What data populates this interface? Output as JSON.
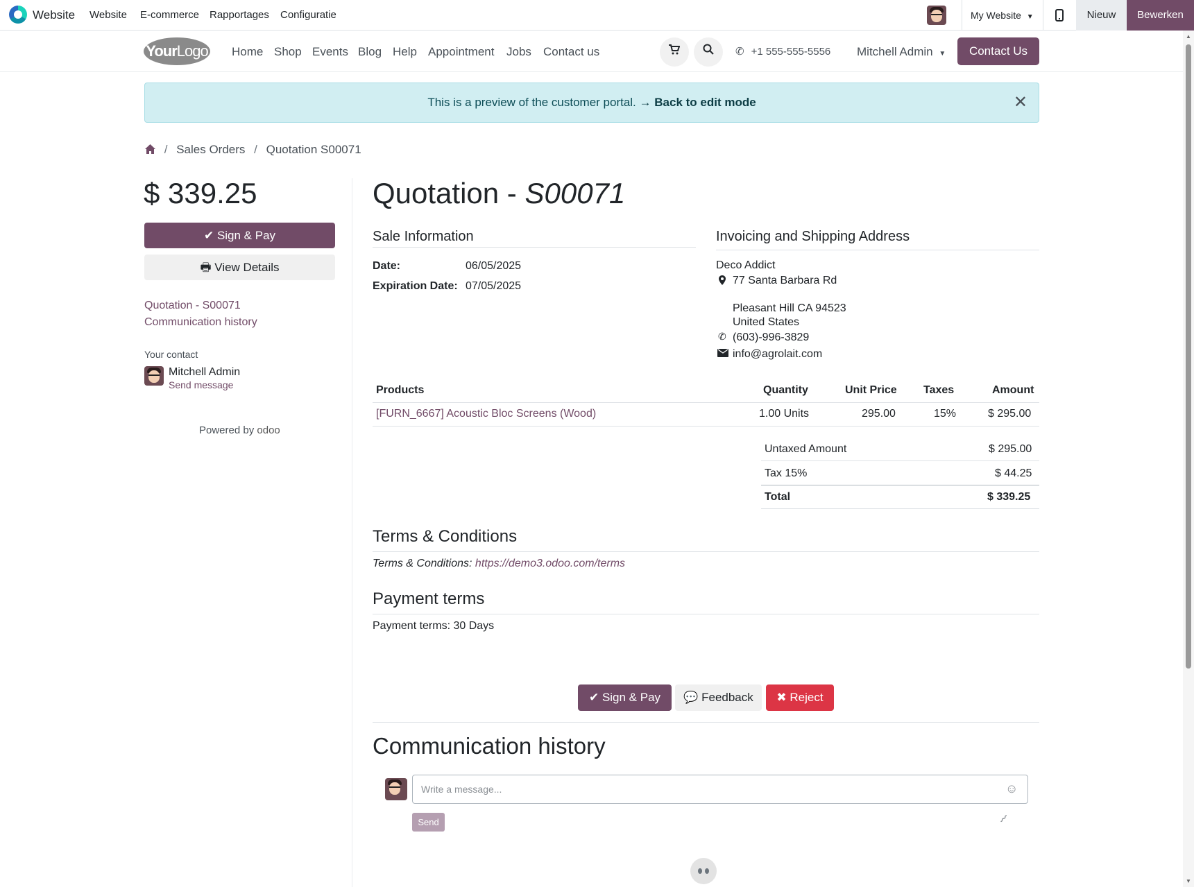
{
  "admin_bar": {
    "app_name": "Website",
    "menu": [
      "Website",
      "E-commerce",
      "Rapportages",
      "Configuratie"
    ],
    "website_selector": "My Website",
    "new_label": "Nieuw",
    "edit_label": "Bewerken"
  },
  "site_header": {
    "logo_text_bold": "Your",
    "logo_text_light": "Logo",
    "nav": [
      "Home",
      "Shop",
      "Events",
      "Blog",
      "Help",
      "Appointment",
      "Jobs",
      "Contact us"
    ],
    "phone": "+1 555-555-5556",
    "user": "Mitchell Admin",
    "contact_button": "Contact Us"
  },
  "alert": {
    "text": "This is a preview of the customer portal.",
    "link": "→ Back to edit mode"
  },
  "breadcrumb": {
    "items": [
      "Sales Orders",
      "Quotation S00071"
    ]
  },
  "sidebar": {
    "amount": "$ 339.25",
    "sign_pay": "Sign & Pay",
    "view_details": "View Details",
    "links": [
      "Quotation - S00071",
      "Communication history"
    ],
    "contact_label": "Your contact",
    "contact_name": "Mitchell Admin",
    "send_message": "Send message",
    "powered_by": "Powered by",
    "powered_brand": "odoo"
  },
  "quotation": {
    "title_prefix": "Quotation - ",
    "number": "S00071",
    "sale_info_title": "Sale Information",
    "date_label": "Date:",
    "date_value": "06/05/2025",
    "exp_label": "Expiration Date:",
    "exp_value": "07/05/2025",
    "address_title": "Invoicing and Shipping Address",
    "customer": "Deco Addict",
    "street": "77 Santa Barbara Rd",
    "city_line": "Pleasant Hill CA 94523",
    "country": "United States",
    "phone": "(603)-996-3829",
    "email": "info@agrolait.com"
  },
  "table": {
    "headers": [
      "Products",
      "Quantity",
      "Unit Price",
      "Taxes",
      "Amount"
    ],
    "rows": [
      {
        "product": "[FURN_6667] Acoustic Bloc Screens (Wood)",
        "quantity": "1.00 Units",
        "unit_price": "295.00",
        "taxes": "15%",
        "amount": "$ 295.00"
      }
    ]
  },
  "totals": {
    "untaxed_label": "Untaxed Amount",
    "untaxed_value": "$ 295.00",
    "tax_label": "Tax 15%",
    "tax_value": "$ 44.25",
    "total_label": "Total",
    "total_value": "$ 339.25"
  },
  "terms": {
    "title": "Terms & Conditions",
    "label": "Terms & Conditions:",
    "link": "https://demo3.odoo.com/terms"
  },
  "payment": {
    "title": "Payment terms",
    "text": "Payment terms: 30 Days"
  },
  "actions": {
    "sign_pay": "Sign & Pay",
    "feedback": "Feedback",
    "reject": "Reject"
  },
  "communication": {
    "title": "Communication history",
    "placeholder": "Write a message...",
    "send": "Send"
  }
}
